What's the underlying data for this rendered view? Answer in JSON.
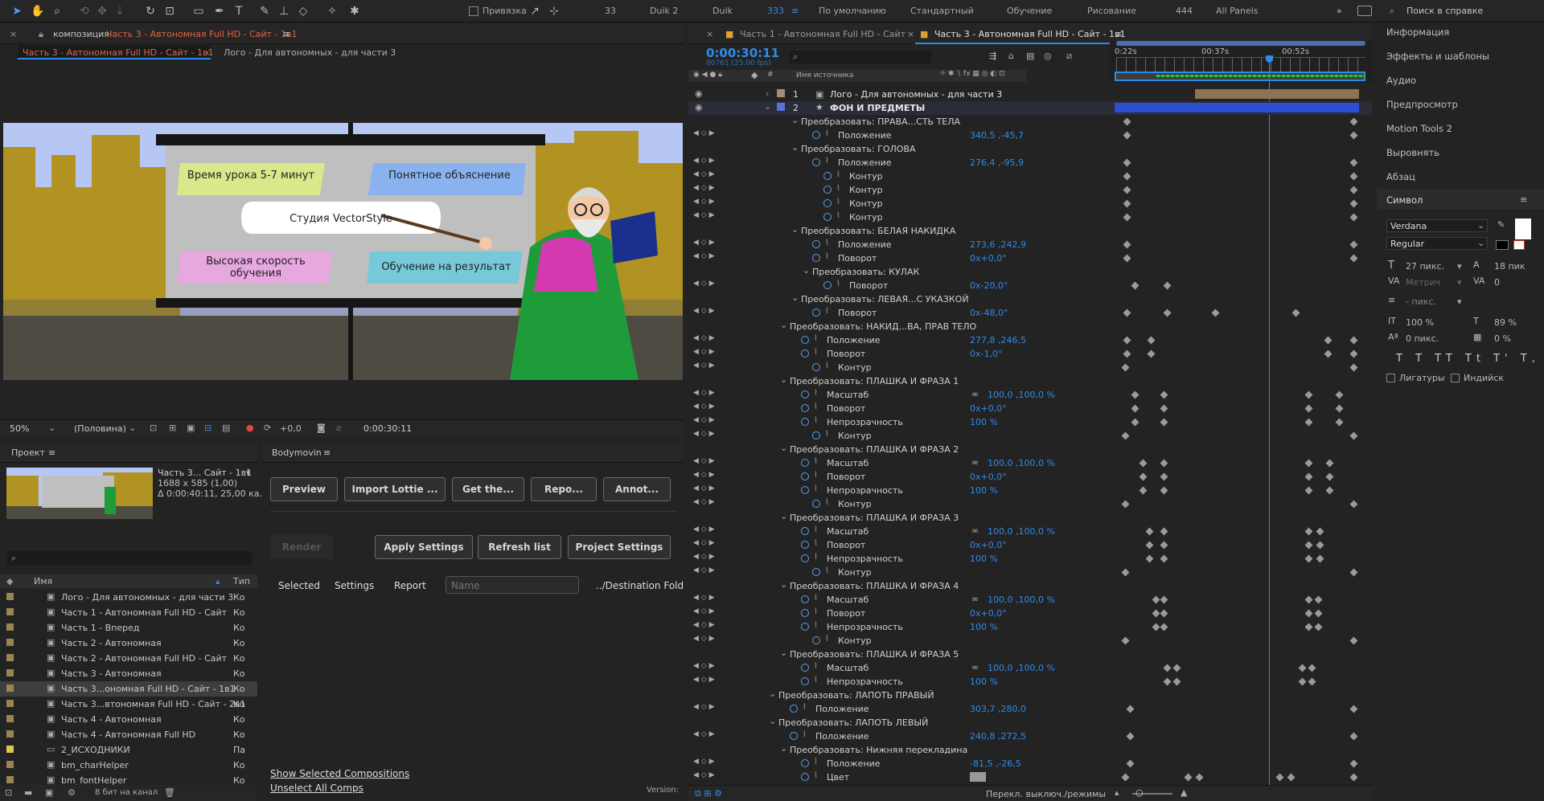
{
  "toolbar": {
    "snap_label": "Привязка",
    "workspaces": [
      "33",
      "Duik 2",
      "Duik",
      "333",
      "По умолчанию",
      "Стандартный",
      "Обучение",
      "Рисование",
      "444",
      "All Panels"
    ],
    "search_placeholder": "Поиск в справке"
  },
  "comp_viewer": {
    "panel_prefix": "композиция",
    "panel_title": "Часть 3 - Автономная Full HD - Сайт - 1в1",
    "crumb_active": "Часть 3 - Автономная Full HD - Сайт - 1в1",
    "crumb_next": "Лого - Для автономных - для части 3",
    "zoom": "50%",
    "resolution": "(Половина)",
    "exposure": "+0,0",
    "timecode": "0:00:30:11",
    "canvas": {
      "tags": [
        "Время урока 5-7 минут",
        "Понятное объяснение",
        "Студия VectorStyle",
        "Высокая скорость обучения",
        "Обучение на результат"
      ]
    }
  },
  "project": {
    "title": "Проект",
    "comp_name": "Часть 3... Сайт - 1в1",
    "comp_size": "1688 x 585 (1,00)",
    "comp_duration": "Δ 0:00:40:11, 25,00 кa...",
    "col_name": "Имя",
    "col_type": "Тип",
    "items": [
      {
        "name": "Лого - Для автономных - для части 3",
        "type": "Ко"
      },
      {
        "name": "Часть 1 - Автономная Full HD - Сайт",
        "type": "Ко"
      },
      {
        "name": "Часть 1 - Вперед",
        "type": "Ко"
      },
      {
        "name": "Часть 2 - Автономная",
        "type": "Ко"
      },
      {
        "name": "Часть 2 - Автономная Full HD - Сайт",
        "type": "Ко"
      },
      {
        "name": "Часть 3 - Автономная",
        "type": "Ко"
      },
      {
        "name": "Часть 3...ономная Full HD - Сайт - 1в1",
        "type": "Ко"
      },
      {
        "name": "Часть 3...втономная Full HD - Сайт - 2в1",
        "type": "Ко"
      },
      {
        "name": "Часть 4 - Автономная",
        "type": "Ко"
      },
      {
        "name": "Часть 4 - Автономная Full HD",
        "type": "Ко"
      },
      {
        "name": "2_ИСХОДНИКИ",
        "type": "Па"
      },
      {
        "name": "bm_charHelper",
        "type": "Ко"
      },
      {
        "name": "bm_fontHelper",
        "type": "Ко"
      }
    ],
    "footer": "8 бит на канал"
  },
  "bodymovin": {
    "title": "Bodymovin",
    "buttons": [
      "Preview",
      "Import Lottie ...",
      "Get the...",
      "Repo...",
      "Annot..."
    ],
    "render": "Render",
    "apply": "Apply Settings",
    "refresh": "Refresh list",
    "project_settings": "Project Settings",
    "col_selected": "Selected",
    "col_settings": "Settings",
    "col_report": "Report",
    "name_placeholder": "Name",
    "destination": "../Destination Fold",
    "show_selected": "Show Selected Compositions",
    "unselect": "Unselect All Comps",
    "version": "Version:"
  },
  "timeline": {
    "tabs": [
      "Часть 1 - Автономная Full HD - Сайт",
      "Часть 3 - Автономная Full HD - Сайт - 1в1"
    ],
    "timecode": "0:00:30:11",
    "frame": "00761 (25.00 fps)",
    "src_col": "Имя источника",
    "ruler": [
      "0:22s",
      "00:37s",
      "00:52s"
    ],
    "layers": [
      {
        "num": "1",
        "name": "Лого - Для автономных - для части 3"
      },
      {
        "num": "2",
        "name": "ФОН И ПРЕДМЕТЫ"
      }
    ],
    "rows": [
      {
        "t": "g",
        "label": "Преобразовать: ПРАВА...СТЬ ТЕЛА",
        "ind": 0
      },
      {
        "t": "p",
        "label": "Положение",
        "val": "340,5 ,-45,7",
        "ind": 0
      },
      {
        "t": "g",
        "label": "Преобразовать: ГОЛОВА",
        "ind": 0
      },
      {
        "t": "p",
        "label": "Положение",
        "val": "276,4 ,-95,9",
        "ind": 0
      },
      {
        "t": "p",
        "label": "Контур",
        "val": "",
        "ind": 1
      },
      {
        "t": "p",
        "label": "Контур",
        "val": "",
        "ind": 1
      },
      {
        "t": "p",
        "label": "Контур",
        "val": "",
        "ind": 1
      },
      {
        "t": "p",
        "label": "Контур",
        "val": "",
        "ind": 1
      },
      {
        "t": "g",
        "label": "Преобразовать: БЕЛАЯ НАКИДКА",
        "ind": 0
      },
      {
        "t": "p",
        "label": "Положение",
        "val": "273,6 ,242,9",
        "ind": 0
      },
      {
        "t": "p",
        "label": "Поворот",
        "val": "0x+0,0°",
        "ind": 0
      },
      {
        "t": "g",
        "label": "Преобразовать: КУЛАК",
        "ind": 1
      },
      {
        "t": "p",
        "label": "Поворот",
        "val": "0x-20,0°",
        "ind": 1
      },
      {
        "t": "g",
        "label": "Преобразовать: ЛЕВАЯ...С УКАЗКОЙ",
        "ind": 0
      },
      {
        "t": "p",
        "label": "Поворот",
        "val": "0x-48,0°",
        "ind": 0
      },
      {
        "t": "g",
        "label": "Преобразовать: НАКИД...ВА, ПРАВ ТЕЛО",
        "ind": -1
      },
      {
        "t": "p",
        "label": "Положение",
        "val": "277,8 ,246,5",
        "ind": -1
      },
      {
        "t": "p",
        "label": "Поворот",
        "val": "0x-1,0°",
        "ind": -1
      },
      {
        "t": "p",
        "label": "Контур",
        "val": "",
        "ind": 0
      },
      {
        "t": "g",
        "label": "Преобразовать: ПЛАШКА И ФРАЗА 1",
        "ind": -1
      },
      {
        "t": "p",
        "label": "Масштаб",
        "val": "100,0 ,100,0 %",
        "ind": -1
      },
      {
        "t": "p",
        "label": "Поворот",
        "val": "0x+0,0°",
        "ind": -1
      },
      {
        "t": "p",
        "label": "Непрозрачность",
        "val": "100 %",
        "ind": -1
      },
      {
        "t": "p",
        "label": "Контур",
        "val": "",
        "ind": 0
      },
      {
        "t": "g",
        "label": "Преобразовать: ПЛАШКА И ФРАЗА 2",
        "ind": -1
      },
      {
        "t": "p",
        "label": "Масштаб",
        "val": "100,0 ,100,0 %",
        "ind": -1
      },
      {
        "t": "p",
        "label": "Поворот",
        "val": "0x+0,0°",
        "ind": -1
      },
      {
        "t": "p",
        "label": "Непрозрачность",
        "val": "100 %",
        "ind": -1
      },
      {
        "t": "p",
        "label": "Контур",
        "val": "",
        "ind": 0
      },
      {
        "t": "g",
        "label": "Преобразовать: ПЛАШКА И ФРАЗА 3",
        "ind": -1
      },
      {
        "t": "p",
        "label": "Масштаб",
        "val": "100,0 ,100,0 %",
        "ind": -1
      },
      {
        "t": "p",
        "label": "Поворот",
        "val": "0x+0,0°",
        "ind": -1
      },
      {
        "t": "p",
        "label": "Непрозрачность",
        "val": "100 %",
        "ind": -1
      },
      {
        "t": "p",
        "label": "Контур",
        "val": "",
        "ind": 0
      },
      {
        "t": "g",
        "label": "Преобразовать: ПЛАШКА И ФРАЗА 4",
        "ind": -1
      },
      {
        "t": "p",
        "label": "Масштаб",
        "val": "100,0 ,100,0 %",
        "ind": -1
      },
      {
        "t": "p",
        "label": "Поворот",
        "val": "0x+0,0°",
        "ind": -1
      },
      {
        "t": "p",
        "label": "Непрозрачность",
        "val": "100 %",
        "ind": -1
      },
      {
        "t": "p",
        "label": "Контур",
        "val": "",
        "ind": 0
      },
      {
        "t": "g",
        "label": "Преобразовать: ПЛАШКА И ФРАЗА 5",
        "ind": -1
      },
      {
        "t": "p",
        "label": "Масштаб",
        "val": "100,0 ,100,0 %",
        "ind": -1
      },
      {
        "t": "p",
        "label": "Непрозрачность",
        "val": "100 %",
        "ind": -1
      },
      {
        "t": "g",
        "label": "Преобразовать: ЛАПОТЬ ПРАВЫЙ",
        "ind": -2
      },
      {
        "t": "p",
        "label": "Положение",
        "val": "303,7 ,280,0",
        "ind": -2
      },
      {
        "t": "g",
        "label": "Преобразовать: ЛАПОТЬ ЛЕВЫЙ",
        "ind": -2
      },
      {
        "t": "p",
        "label": "Положение",
        "val": "240,8 ,272,5",
        "ind": -2
      },
      {
        "t": "g",
        "label": "Преобразовать: Нижняя перекладина",
        "ind": -1
      },
      {
        "t": "p",
        "label": "Положение",
        "val": "-81,5 ,-26,5",
        "ind": -1
      },
      {
        "t": "p",
        "label": "Цвет",
        "val": "",
        "ind": -1
      }
    ],
    "footer": "Перекл. выключ./режимы"
  },
  "right_panel": {
    "items": [
      "Информация",
      "Эффекты и шаблоны",
      "Аудио",
      "Предпросмотр",
      "Motion Tools 2",
      "Выровнять",
      "Абзац",
      "Символ"
    ],
    "font": "Verdana",
    "style": "Regular",
    "size": "27 пикс.",
    "leading": "18 пик",
    "kerning": "Метрич",
    "tracking": "0",
    "stroke": "- пикс.",
    "vscale": "100 %",
    "hscale": "89 %",
    "baseline": "0 пикс.",
    "tsume": "0 %",
    "ligatures": "Лигатуры",
    "hindi": "Индийск"
  }
}
